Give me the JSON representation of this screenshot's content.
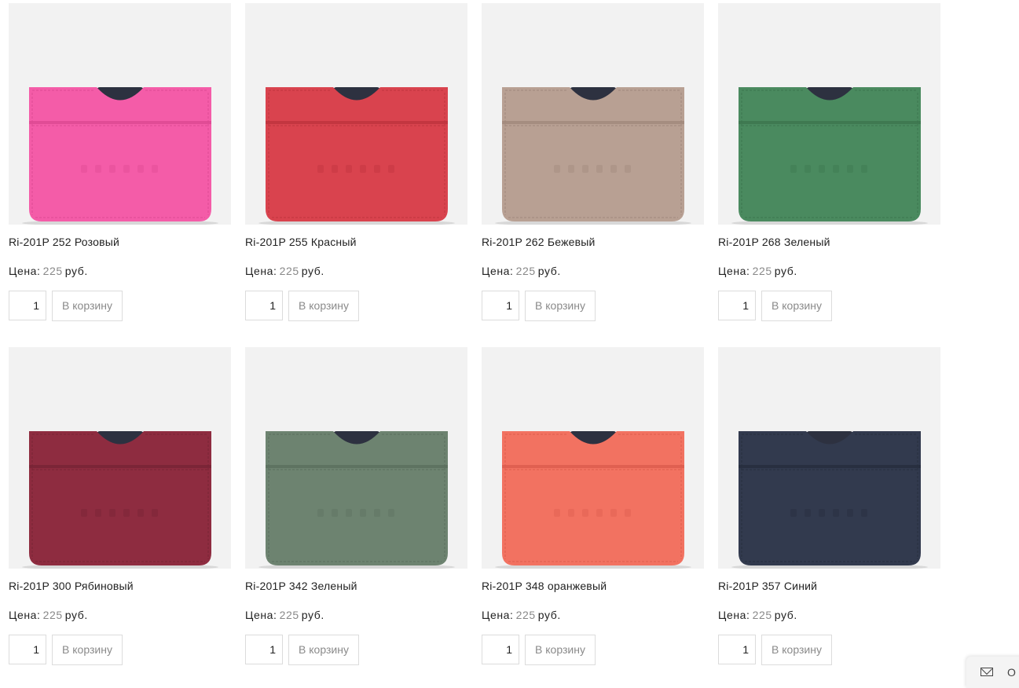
{
  "products": [
    {
      "title": "Ri-201P 252 Розовый",
      "price_label": "Цена:",
      "price_value": "225",
      "currency": "руб.",
      "qty": "1",
      "cart_label": "В корзину",
      "color": "#f45ca8",
      "color_dark": "#d9468f"
    },
    {
      "title": "Ri-201P 255 Красный",
      "price_label": "Цена:",
      "price_value": "225",
      "currency": "руб.",
      "qty": "1",
      "cart_label": "В корзину",
      "color": "#d9434e",
      "color_dark": "#b9313b"
    },
    {
      "title": "Ri-201P 262 Бежевый",
      "price_label": "Цена:",
      "price_value": "225",
      "currency": "руб.",
      "qty": "1",
      "cart_label": "В корзину",
      "color": "#b8a093",
      "color_dark": "#9c8578"
    },
    {
      "title": "Ri-201P 268 Зеленый",
      "price_label": "Цена:",
      "price_value": "225",
      "currency": "руб.",
      "qty": "1",
      "cart_label": "В корзину",
      "color": "#4a8a5f",
      "color_dark": "#3a724c"
    },
    {
      "title": "Ri-201P 300 Рябиновый",
      "price_label": "Цена:",
      "price_value": "225",
      "currency": "руб.",
      "qty": "1",
      "cart_label": "В корзину",
      "color": "#8e2c40",
      "color_dark": "#742233"
    },
    {
      "title": "Ri-201P 342 Зеленый",
      "price_label": "Цена:",
      "price_value": "225",
      "currency": "руб.",
      "qty": "1",
      "cart_label": "В корзину",
      "color": "#6d8370",
      "color_dark": "#586c5b"
    },
    {
      "title": "Ri-201P 348 оранжевый",
      "price_label": "Цена:",
      "price_value": "225",
      "currency": "руб.",
      "qty": "1",
      "cart_label": "В корзину",
      "color": "#f27261",
      "color_dark": "#d9594a"
    },
    {
      "title": "Ri-201P 357 Синий",
      "price_label": "Цена:",
      "price_value": "225",
      "currency": "руб.",
      "qty": "1",
      "cart_label": "В корзину",
      "color": "#323a4e",
      "color_dark": "#242b3b"
    }
  ],
  "feedback": {
    "label": "О",
    "icon": "envelope-icon"
  }
}
